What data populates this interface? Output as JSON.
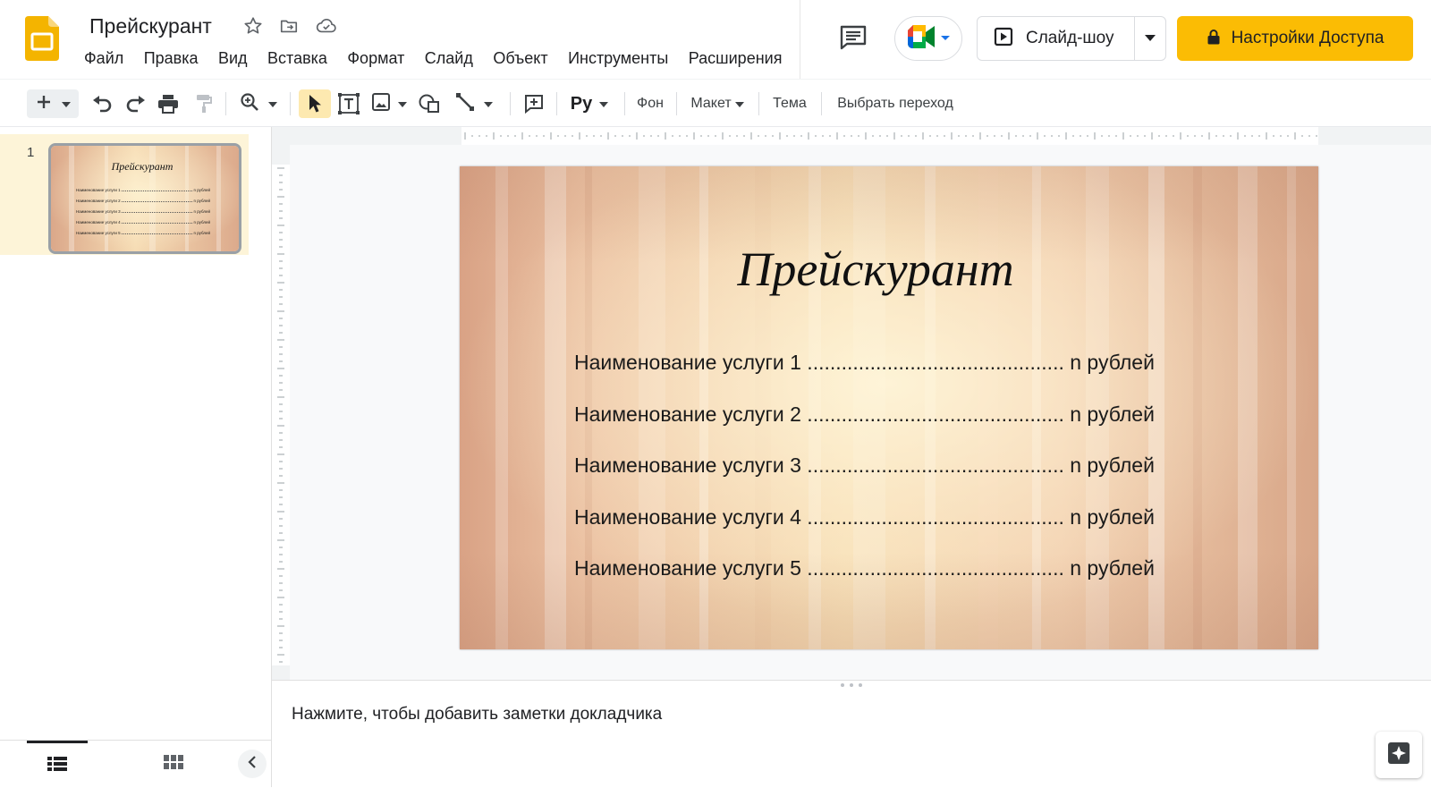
{
  "app": {
    "doc_title": "Прейскурант",
    "logo_icon": "google-slides-logo",
    "accent_color": "#fbbc04"
  },
  "menu": {
    "items": [
      "Файл",
      "Правка",
      "Вид",
      "Вставка",
      "Формат",
      "Слайд",
      "Объект",
      "Инструменты",
      "Расширения"
    ]
  },
  "header_actions": {
    "slideshow_label": "Слайд-шоу",
    "share_label": "Настройки Доступа"
  },
  "toolbar": {
    "font_button": "Pу",
    "background_label": "Фон",
    "layout_label": "Макет",
    "theme_label": "Тема",
    "transition_label": "Выбрать переход"
  },
  "filmstrip": {
    "slides": [
      {
        "number": "1",
        "title": "Прейскурант",
        "rows": [
          {
            "name": "Наименование услуги 1",
            "price": "n рублей"
          },
          {
            "name": "Наименование услуги 2",
            "price": "n рублей"
          },
          {
            "name": "Наименование услуги 3",
            "price": "n рублей"
          },
          {
            "name": "Наименование услуги 4",
            "price": "n рублей"
          },
          {
            "name": "Наименование услуги 5",
            "price": "n рублей"
          }
        ]
      }
    ]
  },
  "slide": {
    "title": "Прейскурант",
    "rows": [
      "Наименование услуги 1 ............................................. n рублей",
      "Наименование услуги 2 ............................................. n рублей",
      "Наименование услуги 3 ............................................. n рублей",
      "Наименование услуги 4 ............................................. n рублей",
      "Наименование услуги 5 ............................................. n рублей"
    ]
  },
  "notes": {
    "placeholder": "Нажмите, чтобы добавить заметки докладчика"
  }
}
